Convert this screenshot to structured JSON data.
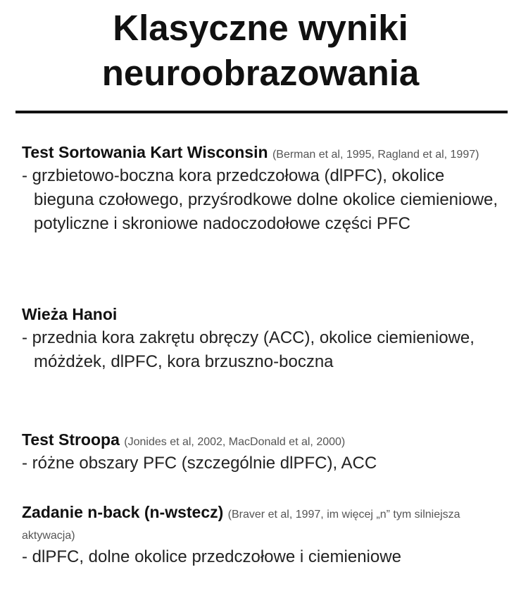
{
  "title": {
    "line1": "Klasyczne wyniki",
    "line2": "neuroobrazowania"
  },
  "sections": [
    {
      "name": "Test Sortowania Kart Wisconsin",
      "citation": "(Berman et al, 1995, Ragland et al, 1997)",
      "text": "- grzbietowo-boczna kora przedczołowa (dlPFC), okolice bieguna czołowego, przyśrodkowe dolne okolice ciemieniowe, potyliczne i skroniowe nadoczodołowe części PFC"
    },
    {
      "name": "Wieża Hanoi",
      "citation": "",
      "text": "- przednia kora zakrętu obręczy (ACC), okolice ciemieniowe, móżdżek, dlPFC, kora brzuszno-boczna"
    },
    {
      "name": "Test Stroopa",
      "citation": "(Jonides et al, 2002, MacDonald et al, 2000)",
      "text": "- różne obszary PFC (szczególnie dlPFC), ACC"
    },
    {
      "name": "Zadanie n-back (n-wstecz)",
      "citation": "(Braver et al, 1997, im więcej „n” tym silniejsza aktywacja)",
      "text": "- dlPFC, dolne okolice przedczołowe i ciemieniowe"
    }
  ]
}
